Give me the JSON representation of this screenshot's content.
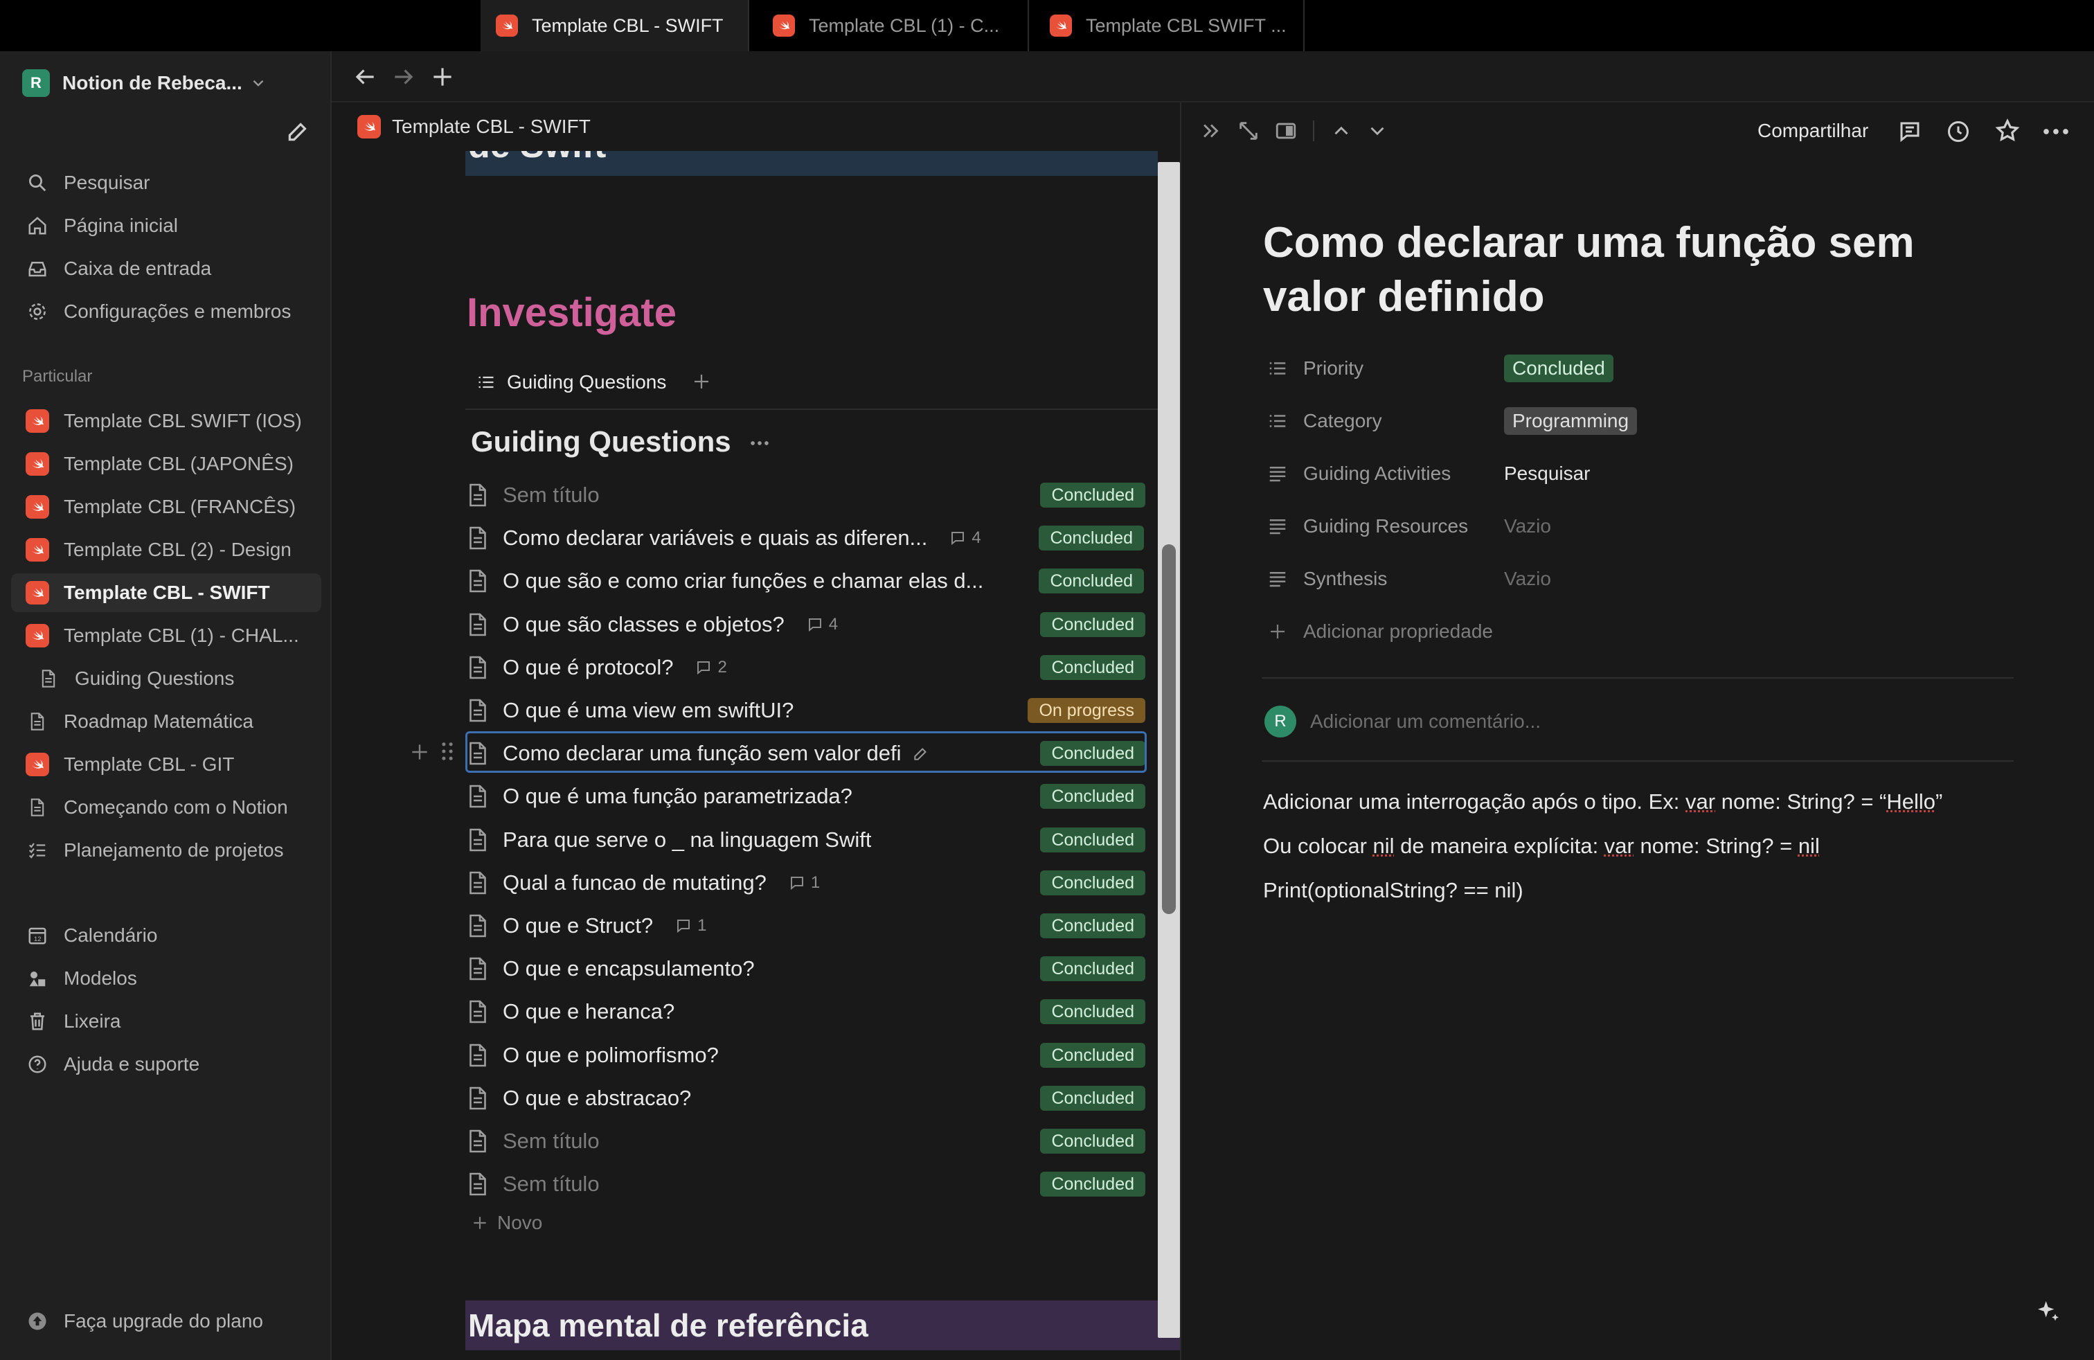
{
  "workspace": {
    "name": "Notion de Rebeca...",
    "avatar": "R"
  },
  "sidebar": {
    "nav": [
      {
        "label": "Pesquisar",
        "icon": "search-icon"
      },
      {
        "label": "Página inicial",
        "icon": "home-icon"
      },
      {
        "label": "Caixa de entrada",
        "icon": "inbox-icon"
      },
      {
        "label": "Configurações e membros",
        "icon": "gear-icon"
      }
    ],
    "section_label": "Particular",
    "pages": [
      {
        "label": "Template CBL SWIFT (IOS)"
      },
      {
        "label": "Template CBL (JAPONÊS)"
      },
      {
        "label": "Template CBL (FRANCÊS)"
      },
      {
        "label": "Template CBL (2) - Design"
      },
      {
        "label": "Template CBL - SWIFT"
      },
      {
        "label": "Template CBL (1) - CHAL..."
      },
      {
        "label": "Guiding Questions"
      },
      {
        "label": "Roadmap Matemática"
      },
      {
        "label": "Template CBL - GIT"
      },
      {
        "label": "Começando com o Notion"
      },
      {
        "label": "Planejamento de projetos"
      }
    ],
    "bottom": [
      {
        "label": "Calendário",
        "icon": "calendar-icon"
      },
      {
        "label": "Modelos",
        "icon": "templates-icon"
      },
      {
        "label": "Lixeira",
        "icon": "trash-icon"
      },
      {
        "label": "Ajuda e suporte",
        "icon": "help-icon"
      }
    ],
    "upgrade": "Faça upgrade do plano"
  },
  "tabs": [
    {
      "label": "Template CBL - SWIFT"
    },
    {
      "label": "Template CBL (1) - C..."
    },
    {
      "label": "Template CBL SWIFT ..."
    }
  ],
  "breadcrumb": "Template CBL - SWIFT",
  "main": {
    "cut_heading": "de Swift",
    "section_title": "Investigate",
    "view_tab": "Guiding Questions",
    "db_title": "Guiding Questions",
    "rows": [
      {
        "title": "Sem título",
        "status": "Concluded",
        "comments": ""
      },
      {
        "title": "Como declarar variáveis e quais as diferen...",
        "status": "Concluded",
        "comments": "4"
      },
      {
        "title": "O que são e como criar funções e chamar elas d...",
        "status": "Concluded",
        "comments": ""
      },
      {
        "title": "O que são classes e objetos?",
        "status": "Concluded",
        "comments": "4"
      },
      {
        "title": "O que é protocol?",
        "status": "Concluded",
        "comments": "2"
      },
      {
        "title": "O que é uma view em swiftUI?",
        "status": "On progress",
        "comments": ""
      },
      {
        "title": "Como declarar uma função sem valor defi",
        "status": "Concluded",
        "comments": ""
      },
      {
        "title": "O que é uma função parametrizada?",
        "status": "Concluded",
        "comments": ""
      },
      {
        "title": "Para que serve o _ na linguagem Swift",
        "status": "Concluded",
        "comments": ""
      },
      {
        "title": "Qual a funcao de mutating?",
        "status": "Concluded",
        "comments": "1"
      },
      {
        "title": "O que e Struct?",
        "status": "Concluded",
        "comments": "1"
      },
      {
        "title": "O que e encapsulamento?",
        "status": "Concluded",
        "comments": ""
      },
      {
        "title": "O que e heranca?",
        "status": "Concluded",
        "comments": ""
      },
      {
        "title": "O que e polimorfismo?",
        "status": "Concluded",
        "comments": ""
      },
      {
        "title": "O que e abstracao?",
        "status": "Concluded",
        "comments": ""
      },
      {
        "title": "Sem título",
        "status": "Concluded",
        "comments": ""
      },
      {
        "title": "Sem título",
        "status": "Concluded",
        "comments": ""
      }
    ],
    "new_label": "Novo",
    "mindmap_heading": "Mapa mental de referência"
  },
  "peek": {
    "share": "Compartilhar",
    "title": "Como declarar uma função sem valor definido",
    "properties": [
      {
        "name": "Priority",
        "value": "Concluded"
      },
      {
        "name": "Category",
        "value": "Programming"
      },
      {
        "name": "Guiding Activities",
        "value": "Pesquisar"
      },
      {
        "name": "Guiding Resources",
        "value": "Vazio"
      },
      {
        "name": "Synthesis",
        "value": "Vazio"
      }
    ],
    "add_property": "Adicionar propriedade",
    "comment_placeholder": "Adicionar um comentário...",
    "comment_avatar": "R",
    "body": [
      {
        "a": "Adicionar uma interrogação após o tipo. Ex: ",
        "u1": "var",
        "b": " nome: String? = “",
        "u2": "Hello",
        "c": "”"
      },
      {
        "a": "Ou colocar ",
        "u1": "nil",
        "b": " de maneira explícita: ",
        "u2": "var",
        "c": " nome: String? = ",
        "u3": "nil"
      },
      {
        "a": "Print(optionalString? == nil)"
      }
    ]
  },
  "colors": {
    "concluded": "#2b5a3b",
    "on_progress": "#7a5a22",
    "investigate": "#d0609a",
    "swift": "#e8503a"
  }
}
